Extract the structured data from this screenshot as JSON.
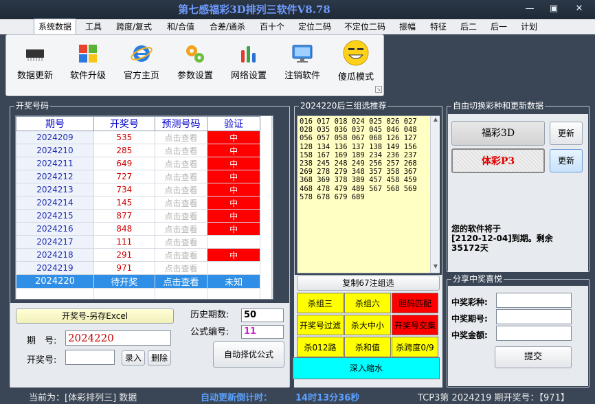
{
  "window": {
    "title": "第七感福彩3D排列三软件V8.78",
    "min": "—",
    "max": "▣",
    "close": "✕"
  },
  "menu": [
    "系统数据",
    "工具",
    "跨度/复式",
    "和/合值",
    "合差/通杀",
    "百十个",
    "定位二码",
    "不定位二码",
    "振幅",
    "特征",
    "后二",
    "后一",
    "计划"
  ],
  "toolbar": [
    "数据更新",
    "软件升级",
    "官方主页",
    "参数设置",
    "网络设置",
    "注销软件",
    "傻瓜模式"
  ],
  "lottery": {
    "group_label": "开奖号码",
    "headers": [
      "期号",
      "开奖号",
      "预测号码",
      "验证"
    ],
    "rows": [
      {
        "period": "2024209",
        "number": "535",
        "pred": "点击查看",
        "check": "中"
      },
      {
        "period": "2024210",
        "number": "285",
        "pred": "点击查看",
        "check": "中"
      },
      {
        "period": "2024211",
        "number": "649",
        "pred": "点击查看",
        "check": "中"
      },
      {
        "period": "2024212",
        "number": "727",
        "pred": "点击查看",
        "check": "中"
      },
      {
        "period": "2024213",
        "number": "734",
        "pred": "点击查看",
        "check": "中"
      },
      {
        "period": "2024214",
        "number": "145",
        "pred": "点击查看",
        "check": "中"
      },
      {
        "period": "2024215",
        "number": "877",
        "pred": "点击查看",
        "check": "中"
      },
      {
        "period": "2024216",
        "number": "848",
        "pred": "点击查看",
        "check": "中"
      },
      {
        "period": "2024217",
        "number": "111",
        "pred": "点击查看",
        "check": ""
      },
      {
        "period": "2024218",
        "number": "291",
        "pred": "点击查看",
        "check": "中"
      },
      {
        "period": "2024219",
        "number": "971",
        "pred": "点击查看",
        "check": ""
      }
    ],
    "last_row": {
      "period": "2024220",
      "number": "待开奖",
      "pred": "点击查看",
      "check": "未知"
    },
    "export_btn": "开奖号-另存Excel",
    "period_label": "期　号:",
    "period_value": "2024220",
    "number_label": "开奖号:",
    "number_value": "",
    "enter_btn": "录入",
    "delete_btn": "删除",
    "history_label": "历史期数:",
    "history_value": "50",
    "formula_label": "公式编号:",
    "formula_value": "11",
    "auto_btn": "自动择优公式"
  },
  "recommend": {
    "group_label": "2024220后三组选推荐",
    "numbers": "016 017 018 024 025 026 027 028 035 036 037 045 046 048 056 057 058 067 068 126 127 128 134 136 137 138 149 156 158 167 169 189 234 236 237 238 245 248 249 256 257 268 269 278 279 348 357 358 367 368 369 378 389 457 458 459 468 478 479 489 567 568 569 578 678 679 689",
    "copy_btn": "复制67注组选",
    "buttons": [
      {
        "label": "杀组三",
        "red": false
      },
      {
        "label": "杀组六",
        "red": false
      },
      {
        "label": "胆码匹配",
        "red": true
      },
      {
        "label": "开奖号过滤",
        "red": false
      },
      {
        "label": "杀大中小",
        "red": false
      },
      {
        "label": "开奖号交集",
        "red": true
      },
      {
        "label": "杀012路",
        "red": false
      },
      {
        "label": "杀和值",
        "red": false
      },
      {
        "label": "杀跨度0/9",
        "red": false
      }
    ],
    "deep_btn": "深入缩水"
  },
  "switch": {
    "group_label": "自由切换彩种和更新数据",
    "fc3d": "福彩3D",
    "p3": "体彩P3",
    "update1": "更新",
    "update2": "更新",
    "expire_line1": "您的软件将于",
    "expire_line2": "[2120-12-04]到期。剩余",
    "expire_line3": "35172天"
  },
  "share": {
    "group_label": "分享中奖喜悦",
    "type_label": "中奖彩种:",
    "period_label": "中奖期号:",
    "amount_label": "中奖金额:",
    "submit": "提交"
  },
  "status": {
    "current": "当前为：[体彩排列三] 数据",
    "countdown_label": "自动更新倒计时：",
    "countdown_value": "14时13分36秒",
    "last": "TCP3第 2024219 期开奖号：【971】"
  },
  "colors": {
    "accent": "#2f8fe6",
    "hit": "#ff0000",
    "yellow": "#ffff00",
    "cyan": "#00ffff"
  }
}
